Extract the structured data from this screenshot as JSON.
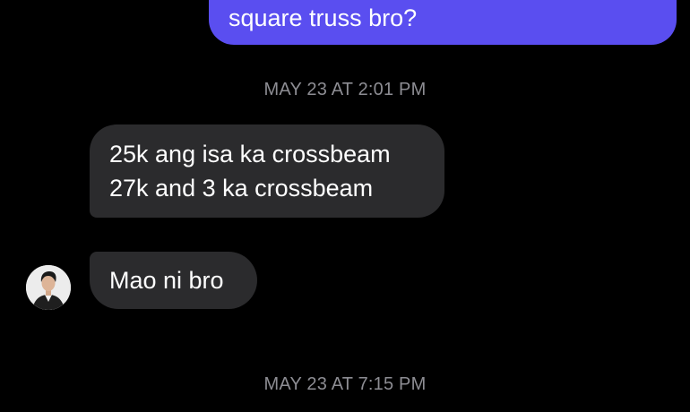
{
  "conversation": {
    "sent_message": "square truss bro?",
    "timestamps": [
      "MAY 23 AT 2:01 PM",
      "MAY 23 AT 7:15 PM"
    ],
    "received_messages": [
      {
        "lines": [
          "25k ang isa ka crossbeam",
          "27k and 3 ka crossbeam"
        ]
      },
      {
        "lines": [
          "Mao ni bro"
        ]
      }
    ]
  },
  "colors": {
    "background": "#000000",
    "sent_bubble": "#5a4ef0",
    "received_bubble": "#2b2b2d",
    "timestamp": "#8d8d93"
  },
  "icons": {
    "contact_avatar": "contact-avatar-photo"
  }
}
